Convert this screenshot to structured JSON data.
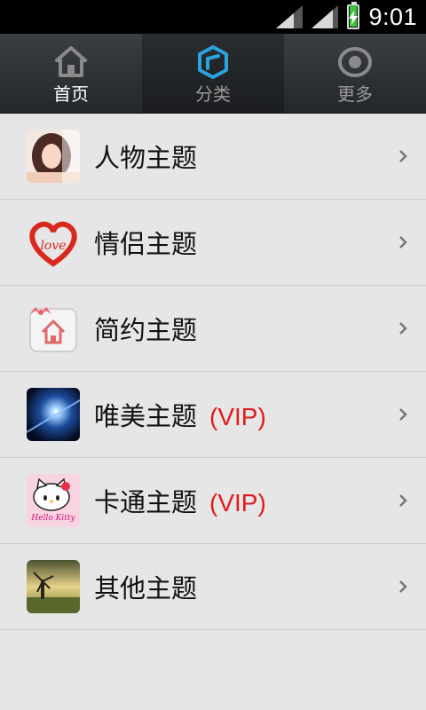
{
  "status_bar": {
    "time": "9:01",
    "battery_color": "#38c53c"
  },
  "tabs": [
    {
      "label": "首页",
      "icon": "home-icon",
      "selected": true
    },
    {
      "label": "分类",
      "icon": "category-cube-icon",
      "selected": false,
      "highlighted": true,
      "accent": "#2aa3e0"
    },
    {
      "label": "更多",
      "icon": "eye-icon",
      "selected": false
    }
  ],
  "themes": [
    {
      "label": "人物主题",
      "vip": "",
      "icon": "portrait-thumbnail-icon"
    },
    {
      "label": "情侣主题",
      "vip": "",
      "icon": "love-heart-icon"
    },
    {
      "label": "简约主题",
      "vip": "",
      "icon": "simple-house-icon"
    },
    {
      "label": "唯美主题",
      "vip": "(VIP)",
      "icon": "galaxy-thumbnail-icon"
    },
    {
      "label": "卡通主题",
      "vip": "(VIP)",
      "icon": "hello-kitty-icon"
    },
    {
      "label": "其他主题",
      "vip": "",
      "icon": "windmill-landscape-icon"
    }
  ],
  "thumb_texts": {
    "love": "love",
    "kitty": "Hello Kitty"
  },
  "colors": {
    "vip": "#e11a1a",
    "tab_accent": "#2aa3e0"
  }
}
